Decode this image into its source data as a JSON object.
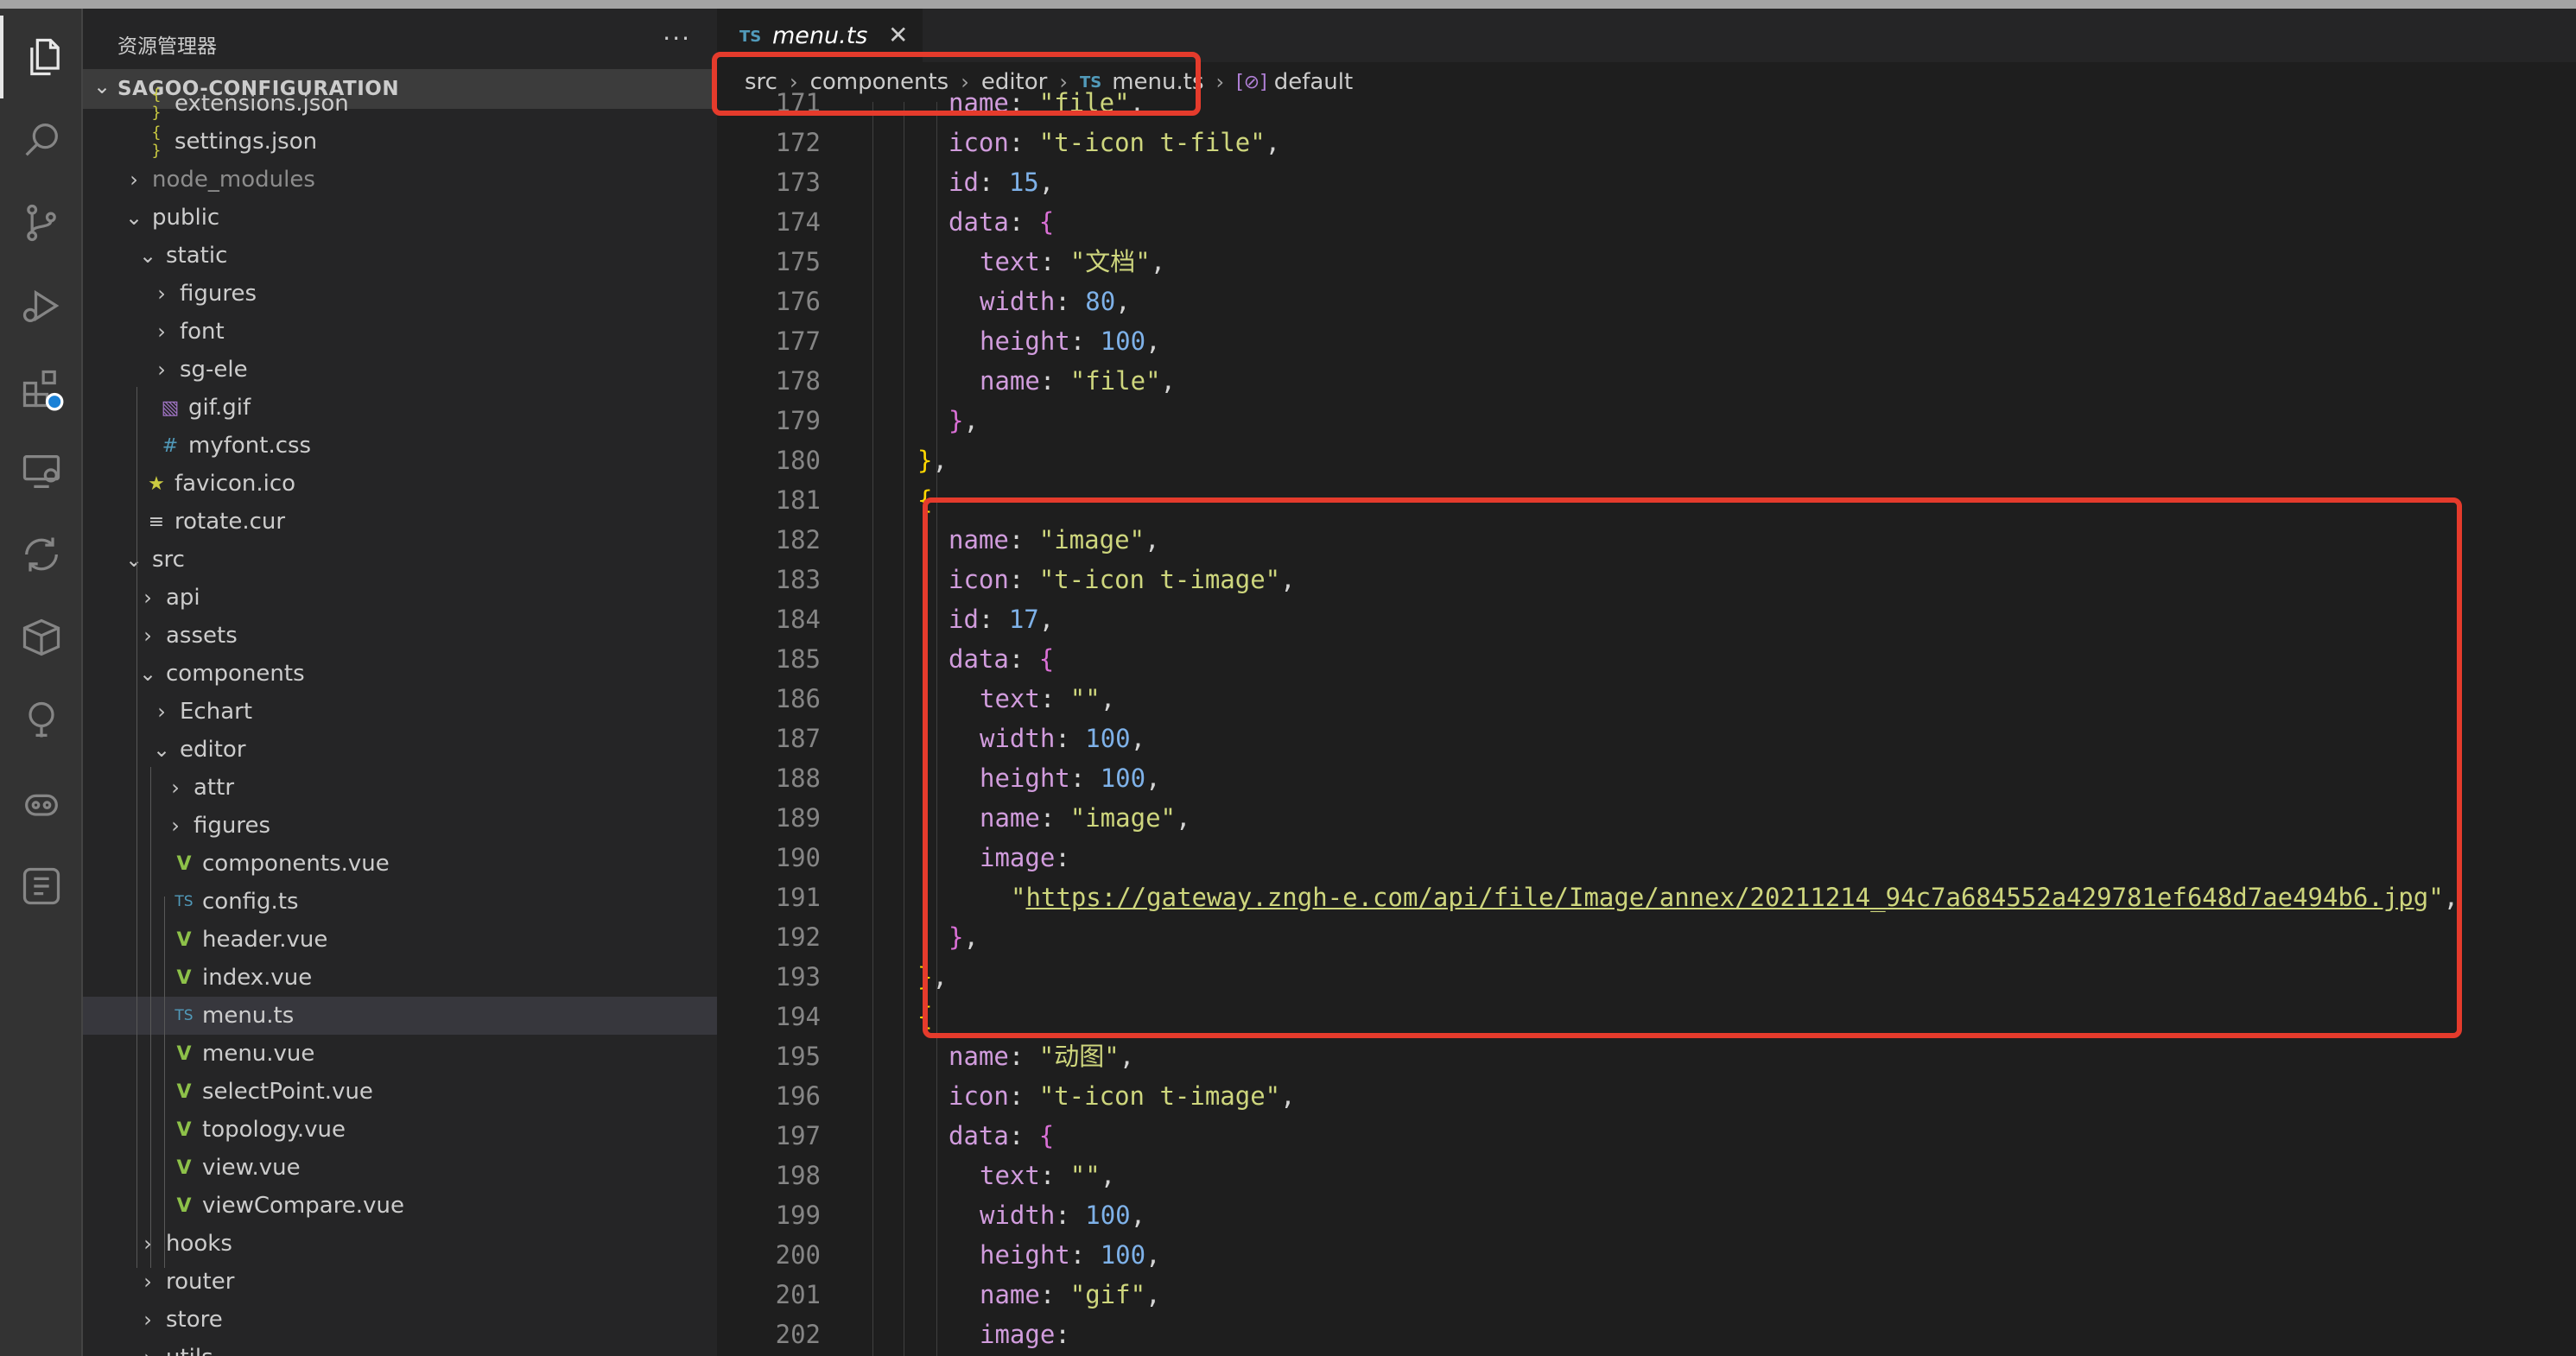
{
  "sidebar": {
    "title": "资源管理器",
    "more": "···",
    "section": "SAGOO-CONFIGURATION",
    "items": [
      {
        "label": "extensions.json",
        "indent": 0,
        "type": "json",
        "partial": true
      },
      {
        "label": "settings.json",
        "indent": 0,
        "type": "json"
      },
      {
        "label": "node_modules",
        "indent": -1,
        "type": "folder-closed",
        "dim": true
      },
      {
        "label": "public",
        "indent": -1,
        "type": "folder-open"
      },
      {
        "label": "static",
        "indent": 0,
        "type": "folder-open"
      },
      {
        "label": "figures",
        "indent": 1,
        "type": "folder-closed"
      },
      {
        "label": "font",
        "indent": 1,
        "type": "folder-closed"
      },
      {
        "label": "sg-ele",
        "indent": 1,
        "type": "folder-closed"
      },
      {
        "label": "gif.gif",
        "indent": 1,
        "type": "image"
      },
      {
        "label": "myfont.css",
        "indent": 1,
        "type": "css"
      },
      {
        "label": "favicon.ico",
        "indent": 0,
        "type": "star"
      },
      {
        "label": "rotate.cur",
        "indent": 0,
        "type": "text"
      },
      {
        "label": "src",
        "indent": -1,
        "type": "folder-open"
      },
      {
        "label": "api",
        "indent": 0,
        "type": "folder-closed"
      },
      {
        "label": "assets",
        "indent": 0,
        "type": "folder-closed"
      },
      {
        "label": "components",
        "indent": 0,
        "type": "folder-open"
      },
      {
        "label": "Echart",
        "indent": 1,
        "type": "folder-closed"
      },
      {
        "label": "editor",
        "indent": 1,
        "type": "folder-open"
      },
      {
        "label": "attr",
        "indent": 2,
        "type": "folder-closed"
      },
      {
        "label": "figures",
        "indent": 2,
        "type": "folder-closed"
      },
      {
        "label": "components.vue",
        "indent": 2,
        "type": "vue"
      },
      {
        "label": "config.ts",
        "indent": 2,
        "type": "ts"
      },
      {
        "label": "header.vue",
        "indent": 2,
        "type": "vue"
      },
      {
        "label": "index.vue",
        "indent": 2,
        "type": "vue"
      },
      {
        "label": "menu.ts",
        "indent": 2,
        "type": "ts",
        "selected": true
      },
      {
        "label": "menu.vue",
        "indent": 2,
        "type": "vue"
      },
      {
        "label": "selectPoint.vue",
        "indent": 2,
        "type": "vue"
      },
      {
        "label": "topology.vue",
        "indent": 2,
        "type": "vue"
      },
      {
        "label": "view.vue",
        "indent": 2,
        "type": "vue"
      },
      {
        "label": "viewCompare.vue",
        "indent": 2,
        "type": "vue"
      },
      {
        "label": "hooks",
        "indent": 0,
        "type": "folder-closed"
      },
      {
        "label": "router",
        "indent": 0,
        "type": "folder-closed"
      },
      {
        "label": "store",
        "indent": 0,
        "type": "folder-closed"
      },
      {
        "label": "utils",
        "indent": 0,
        "type": "folder-closed",
        "partial": true
      }
    ]
  },
  "tab": {
    "lang": "TS",
    "label": "menu.ts",
    "close": "✕"
  },
  "breadcrumb": {
    "parts": [
      "src",
      "components",
      "editor"
    ],
    "file_lang": "TS",
    "file": "menu.ts",
    "symbol_icon": "[⊘]",
    "symbol": "default"
  },
  "code": {
    "lines": [
      {
        "n": "171",
        "indent": 3,
        "tokens": [
          [
            "k",
            "name"
          ],
          [
            "p",
            ": "
          ],
          [
            "s",
            "\"file\""
          ],
          [
            "p",
            ","
          ]
        ]
      },
      {
        "n": "172",
        "indent": 3,
        "tokens": [
          [
            "k",
            "icon"
          ],
          [
            "p",
            ": "
          ],
          [
            "s",
            "\"t-icon t-file\""
          ],
          [
            "p",
            ","
          ]
        ]
      },
      {
        "n": "173",
        "indent": 3,
        "tokens": [
          [
            "k",
            "id"
          ],
          [
            "p",
            ": "
          ],
          [
            "n",
            "15"
          ],
          [
            "p",
            ","
          ]
        ]
      },
      {
        "n": "174",
        "indent": 3,
        "tokens": [
          [
            "k",
            "data"
          ],
          [
            "p",
            ": "
          ],
          [
            "b2",
            "{"
          ]
        ]
      },
      {
        "n": "175",
        "indent": 4,
        "tokens": [
          [
            "k",
            "text"
          ],
          [
            "p",
            ": "
          ],
          [
            "s",
            "\"文档\""
          ],
          [
            "p",
            ","
          ]
        ]
      },
      {
        "n": "176",
        "indent": 4,
        "tokens": [
          [
            "k",
            "width"
          ],
          [
            "p",
            ": "
          ],
          [
            "n",
            "80"
          ],
          [
            "p",
            ","
          ]
        ]
      },
      {
        "n": "177",
        "indent": 4,
        "tokens": [
          [
            "k",
            "height"
          ],
          [
            "p",
            ": "
          ],
          [
            "n",
            "100"
          ],
          [
            "p",
            ","
          ]
        ]
      },
      {
        "n": "178",
        "indent": 4,
        "tokens": [
          [
            "k",
            "name"
          ],
          [
            "p",
            ": "
          ],
          [
            "s",
            "\"file\""
          ],
          [
            "p",
            ","
          ]
        ]
      },
      {
        "n": "179",
        "indent": 3,
        "tokens": [
          [
            "b2",
            "}"
          ],
          [
            "p",
            ","
          ]
        ]
      },
      {
        "n": "180",
        "indent": 2,
        "tokens": [
          [
            "b1",
            "}"
          ],
          [
            "p",
            ","
          ]
        ]
      },
      {
        "n": "181",
        "indent": 2,
        "tokens": [
          [
            "b1",
            "{"
          ]
        ]
      },
      {
        "n": "182",
        "indent": 3,
        "tokens": [
          [
            "k",
            "name"
          ],
          [
            "p",
            ": "
          ],
          [
            "s",
            "\"image\""
          ],
          [
            "p",
            ","
          ]
        ]
      },
      {
        "n": "183",
        "indent": 3,
        "tokens": [
          [
            "k",
            "icon"
          ],
          [
            "p",
            ": "
          ],
          [
            "s",
            "\"t-icon t-image\""
          ],
          [
            "p",
            ","
          ]
        ]
      },
      {
        "n": "184",
        "indent": 3,
        "tokens": [
          [
            "k",
            "id"
          ],
          [
            "p",
            ": "
          ],
          [
            "n",
            "17"
          ],
          [
            "p",
            ","
          ]
        ]
      },
      {
        "n": "185",
        "indent": 3,
        "tokens": [
          [
            "k",
            "data"
          ],
          [
            "p",
            ": "
          ],
          [
            "b2",
            "{"
          ]
        ]
      },
      {
        "n": "186",
        "indent": 4,
        "tokens": [
          [
            "k",
            "text"
          ],
          [
            "p",
            ": "
          ],
          [
            "s",
            "\"\""
          ],
          [
            "p",
            ","
          ]
        ]
      },
      {
        "n": "187",
        "indent": 4,
        "tokens": [
          [
            "k",
            "width"
          ],
          [
            "p",
            ": "
          ],
          [
            "n",
            "100"
          ],
          [
            "p",
            ","
          ]
        ]
      },
      {
        "n": "188",
        "indent": 4,
        "tokens": [
          [
            "k",
            "height"
          ],
          [
            "p",
            ": "
          ],
          [
            "n",
            "100"
          ],
          [
            "p",
            ","
          ]
        ]
      },
      {
        "n": "189",
        "indent": 4,
        "tokens": [
          [
            "k",
            "name"
          ],
          [
            "p",
            ": "
          ],
          [
            "s",
            "\"image\""
          ],
          [
            "p",
            ","
          ]
        ]
      },
      {
        "n": "190",
        "indent": 4,
        "tokens": [
          [
            "k",
            "image"
          ],
          [
            "p",
            ":"
          ]
        ]
      },
      {
        "n": "191",
        "indent": 5,
        "tokens": [
          [
            "s",
            "\""
          ],
          [
            "url",
            "https://gateway.zngh-e.com/api/file/Image/annex/20211214_94c7a684552a429781ef648d7ae494b6.jpg"
          ],
          [
            "s",
            "\""
          ],
          [
            "p",
            ","
          ]
        ]
      },
      {
        "n": "192",
        "indent": 3,
        "tokens": [
          [
            "b2",
            "}"
          ],
          [
            "p",
            ","
          ]
        ]
      },
      {
        "n": "193",
        "indent": 2,
        "tokens": [
          [
            "b1",
            "}"
          ],
          [
            "p",
            ","
          ]
        ]
      },
      {
        "n": "194",
        "indent": 2,
        "tokens": [
          [
            "b1",
            "{"
          ]
        ]
      },
      {
        "n": "195",
        "indent": 3,
        "tokens": [
          [
            "k",
            "name"
          ],
          [
            "p",
            ": "
          ],
          [
            "s",
            "\"动图\""
          ],
          [
            "p",
            ","
          ]
        ]
      },
      {
        "n": "196",
        "indent": 3,
        "tokens": [
          [
            "k",
            "icon"
          ],
          [
            "p",
            ": "
          ],
          [
            "s",
            "\"t-icon t-image\""
          ],
          [
            "p",
            ","
          ]
        ]
      },
      {
        "n": "197",
        "indent": 3,
        "tokens": [
          [
            "k",
            "data"
          ],
          [
            "p",
            ": "
          ],
          [
            "b2",
            "{"
          ]
        ]
      },
      {
        "n": "198",
        "indent": 4,
        "tokens": [
          [
            "k",
            "text"
          ],
          [
            "p",
            ": "
          ],
          [
            "s",
            "\"\""
          ],
          [
            "p",
            ","
          ]
        ]
      },
      {
        "n": "199",
        "indent": 4,
        "tokens": [
          [
            "k",
            "width"
          ],
          [
            "p",
            ": "
          ],
          [
            "n",
            "100"
          ],
          [
            "p",
            ","
          ]
        ]
      },
      {
        "n": "200",
        "indent": 4,
        "tokens": [
          [
            "k",
            "height"
          ],
          [
            "p",
            ": "
          ],
          [
            "n",
            "100"
          ],
          [
            "p",
            ","
          ]
        ]
      },
      {
        "n": "201",
        "indent": 4,
        "tokens": [
          [
            "k",
            "name"
          ],
          [
            "p",
            ": "
          ],
          [
            "s",
            "\"gif\""
          ],
          [
            "p",
            ","
          ]
        ]
      },
      {
        "n": "202",
        "indent": 4,
        "tokens": [
          [
            "k",
            "image"
          ],
          [
            "p",
            ":"
          ]
        ]
      }
    ]
  },
  "colors": {
    "highlight": "#e53b2c",
    "keyword": "#d19cdd",
    "string": "#ced67d",
    "number": "#7eb1e8"
  }
}
